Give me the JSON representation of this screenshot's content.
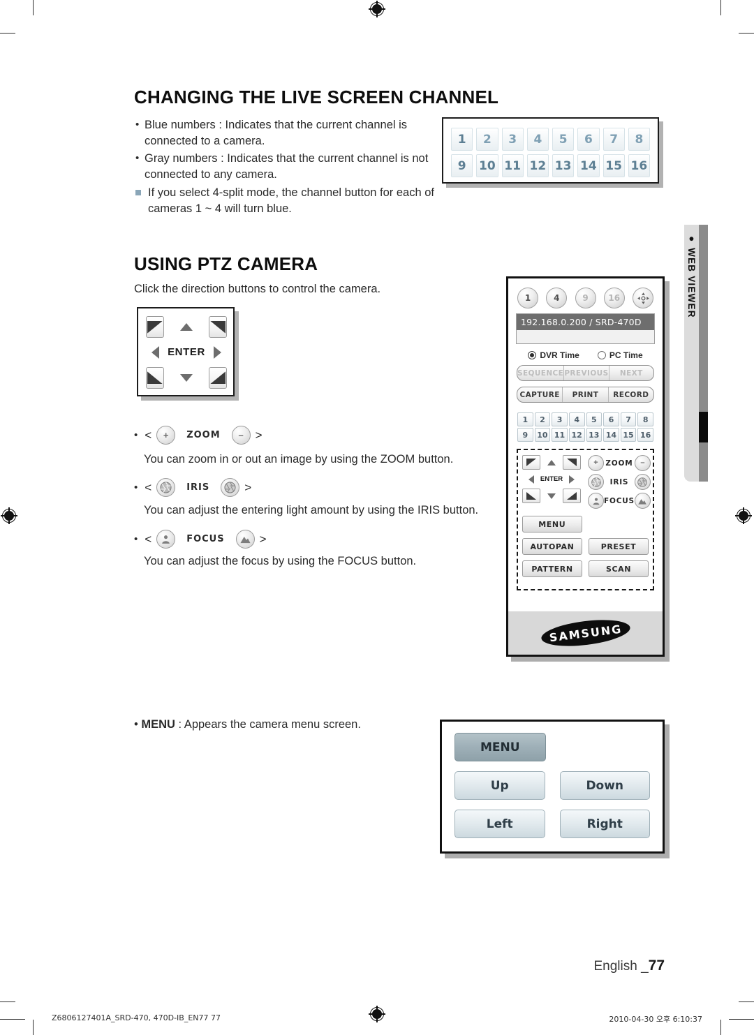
{
  "page": {
    "language_label": "English _",
    "page_number": "77",
    "footer_left": "Z6806127401A_SRD-470, 470D-IB_EN77   77",
    "footer_right": "2010-04-30   오후 6:10:37",
    "side_tab": "WEB VIEWER"
  },
  "section1": {
    "title": "CHANGING THE LIVE SCREEN CHANNEL",
    "bullets": [
      "Blue numbers : Indicates that the current channel is connected to a camera.",
      "Gray numbers : Indicates that the current channel is not connected to any camera."
    ],
    "note": "If you select 4-split mode, the channel button for each of cameras 1 ~ 4 will turn blue."
  },
  "channel_grid": {
    "row1": [
      "1",
      "2",
      "3",
      "4",
      "5",
      "6",
      "7",
      "8"
    ],
    "row2": [
      "9",
      "10",
      "11",
      "12",
      "13",
      "14",
      "15",
      "16"
    ]
  },
  "section2": {
    "title": "USING PTZ CAMERA",
    "intro": "Click the direction buttons to control the camera.",
    "enter_label": "ENTER",
    "controls": [
      {
        "label": "ZOOM",
        "left_icon": "plus-icon",
        "right_icon": "minus-icon",
        "desc": "You can zoom in or out an image by using the ZOOM button."
      },
      {
        "label": "IRIS",
        "left_icon": "iris-open-icon",
        "right_icon": "iris-close-icon",
        "desc": "You can adjust the entering light amount by using the IRIS button."
      },
      {
        "label": "FOCUS",
        "left_icon": "focus-near-icon",
        "right_icon": "focus-far-icon",
        "desc": "You can adjust the focus by using the FOCUS button."
      }
    ],
    "menu_bullet_bold": "MENU",
    "menu_bullet_rest": " : Appears the camera menu screen."
  },
  "remote": {
    "split_buttons": [
      "1",
      "4",
      "9",
      "16"
    ],
    "fullscreen_icon": "expand-arrows-icon",
    "device": "192.168.0.200   / SRD-470D",
    "time_source": [
      {
        "label": "DVR Time",
        "selected": true
      },
      {
        "label": "PC Time",
        "selected": false
      }
    ],
    "nav_bar": {
      "disabled": true,
      "items": [
        "SEQUENCE",
        "PREVIOUS",
        "NEXT"
      ]
    },
    "action_bar": {
      "disabled": false,
      "items": [
        "CAPTURE",
        "PRINT",
        "RECORD"
      ]
    },
    "channels_row1": [
      "1",
      "2",
      "3",
      "4",
      "5",
      "6",
      "7",
      "8"
    ],
    "channels_row2": [
      "9",
      "10",
      "11",
      "12",
      "13",
      "14",
      "15",
      "16"
    ],
    "enter_label": "ENTER",
    "ptz_labels": [
      "ZOOM",
      "IRIS",
      "FOCUS"
    ],
    "buttons": {
      "menu": "MENU",
      "autopan": "AUTOPAN",
      "preset": "PRESET",
      "pattern": "PATTERN",
      "scan": "SCAN"
    },
    "brand": "SAMSUNG"
  },
  "menu_dialog": {
    "menu": "MENU",
    "up": "Up",
    "down": "Down",
    "left": "Left",
    "right": "Right"
  },
  "colors": {
    "channel_blue": "#5d7f93",
    "note_marker": "#8aa6b8",
    "selected_row": "#6e6e6e",
    "side_tab_gray": "#8b8b8b",
    "dialog_button": "#ccd9df"
  }
}
